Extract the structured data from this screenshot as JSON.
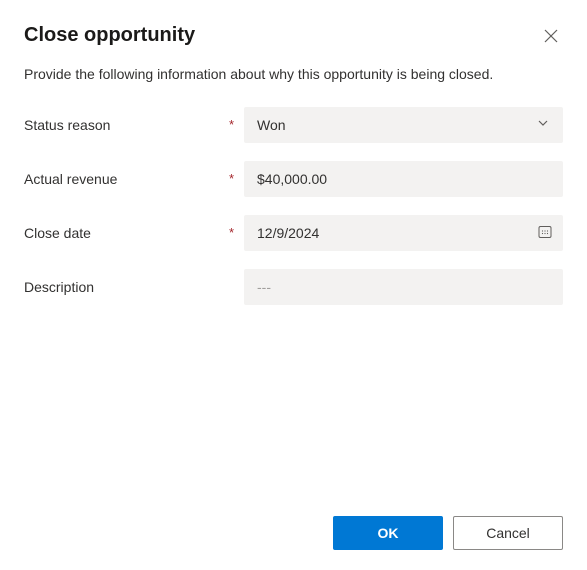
{
  "dialog": {
    "title": "Close opportunity",
    "subtitle": "Provide the following information about why this opportunity is being closed."
  },
  "fields": {
    "status_reason": {
      "label": "Status reason",
      "value": "Won"
    },
    "actual_revenue": {
      "label": "Actual revenue",
      "value": "$40,000.00"
    },
    "close_date": {
      "label": "Close date",
      "value": "12/9/2024"
    },
    "description": {
      "label": "Description",
      "placeholder": "---"
    }
  },
  "buttons": {
    "ok": "OK",
    "cancel": "Cancel"
  },
  "required_marker": "*"
}
